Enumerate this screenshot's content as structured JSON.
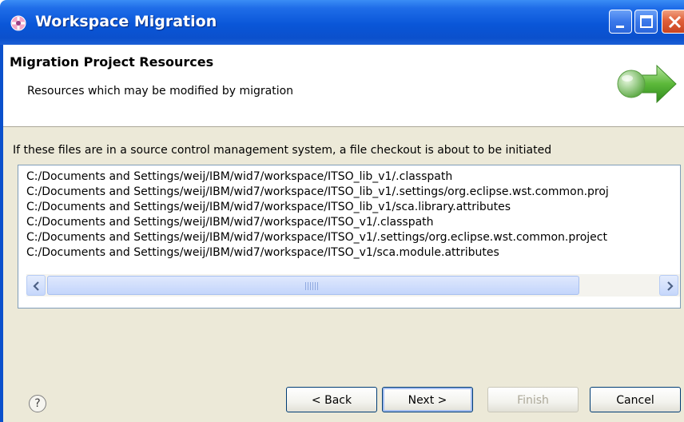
{
  "window": {
    "title": "Workspace Migration",
    "icon": "eclipse-migration-icon",
    "controls": [
      "minimize-icon",
      "maximize-icon",
      "close-icon"
    ]
  },
  "banner": {
    "title": "Migration Project Resources",
    "description": "Resources which may be modified by migration",
    "icon": "migration-arrow-icon"
  },
  "main": {
    "instruction": "If these files are in a source control management system, a file checkout is about to be initiated",
    "files": [
      "C:/Documents and Settings/weij/IBM/wid7/workspace/ITSO_lib_v1/.classpath",
      "C:/Documents and Settings/weij/IBM/wid7/workspace/ITSO_lib_v1/.settings/org.eclipse.wst.common.proj",
      "C:/Documents and Settings/weij/IBM/wid7/workspace/ITSO_lib_v1/sca.library.attributes",
      "C:/Documents and Settings/weij/IBM/wid7/workspace/ITSO_v1/.classpath",
      "C:/Documents and Settings/weij/IBM/wid7/workspace/ITSO_v1/.settings/org.eclipse.wst.common.project",
      "C:/Documents and Settings/weij/IBM/wid7/workspace/ITSO_v1/sca.module.attributes"
    ]
  },
  "footer": {
    "help_icon": "help-icon",
    "help_glyph": "?",
    "back_label": "< Back",
    "next_label": "Next >",
    "finish_label": "Finish",
    "cancel_label": "Cancel"
  },
  "colors": {
    "titlebar": "#0b50cc",
    "dialog_bg": "#ece9d8",
    "banner_bg": "#ffffff",
    "arrow_green": "#5cb83a"
  }
}
